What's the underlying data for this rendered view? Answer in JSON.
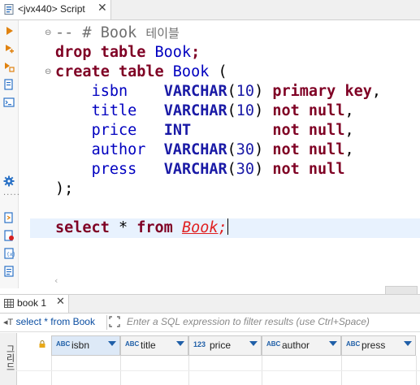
{
  "editor_tab": {
    "label": "<jvx440> Script",
    "close": "✕"
  },
  "code": {
    "comment_line": {
      "prefix": "-- # Book",
      "suffix": "테이블"
    },
    "drop_line": {
      "kw": "drop table",
      "name": "Book",
      "end": ";"
    },
    "create_line": {
      "kw": "create table",
      "name": "Book",
      "paren": "("
    },
    "columns": [
      {
        "name": "isbn",
        "type": "VARCHAR",
        "size": "10",
        "constraint": "primary key",
        "sep": ","
      },
      {
        "name": "title",
        "type": "VARCHAR",
        "size": "10",
        "constraint": "not null",
        "sep": ","
      },
      {
        "name": "price",
        "type": "INT",
        "size": "",
        "constraint": "not null",
        "sep": ","
      },
      {
        "name": "author",
        "type": "VARCHAR",
        "size": "30",
        "constraint": "not null",
        "sep": ","
      },
      {
        "name": "press",
        "type": "VARCHAR",
        "size": "30",
        "constraint": "not null",
        "sep": ""
      }
    ],
    "close_line": ");",
    "select_line": {
      "kw1": "select",
      "star": "*",
      "kw2": "from",
      "name": "Book",
      "end": ";"
    }
  },
  "results": {
    "tab_label": "book 1",
    "tab_close": "✕",
    "query_label": "select * from Book",
    "filter_placeholder": "Enter a SQL expression to filter results (use Ctrl+Space)",
    "side_tab": "그리드",
    "columns": [
      {
        "type_badge": "ABC",
        "name": "isbn"
      },
      {
        "type_badge": "ABC",
        "name": "title"
      },
      {
        "type_badge": "123",
        "name": "price"
      },
      {
        "type_badge": "ABC",
        "name": "author"
      },
      {
        "type_badge": "ABC",
        "name": "press"
      }
    ]
  },
  "colors": {
    "keyword": "#7f0024",
    "identifier": "#0000c0",
    "constraint": "#d00000",
    "error": "#e02020",
    "current_line": "#e8f2fe"
  }
}
